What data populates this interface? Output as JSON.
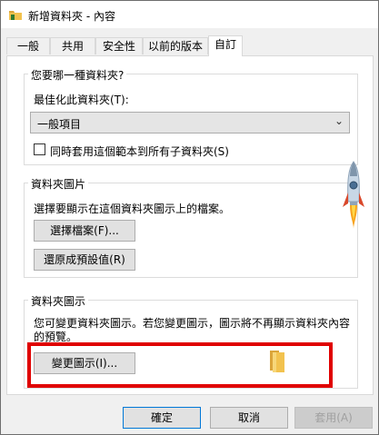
{
  "window": {
    "title": "新增資料夾 - 內容"
  },
  "tabs": [
    {
      "label": "一般",
      "active": false
    },
    {
      "label": "共用",
      "active": false
    },
    {
      "label": "安全性",
      "active": false
    },
    {
      "label": "以前的版本",
      "active": false
    },
    {
      "label": "自訂",
      "active": true
    }
  ],
  "optimize": {
    "group_title": "您要哪一種資料夾?",
    "label": "最佳化此資料夾(T):",
    "selected_value": "一般項目",
    "checkbox_label": "同時套用這個範本到所有子資料夾(S)",
    "checkbox_checked": false
  },
  "pictures": {
    "group_title": "資料夾圖片",
    "description": "選擇要顯示在這個資料夾圖示上的檔案。",
    "choose_file_label": "選擇檔案(F)...",
    "restore_default_label": "還原成預設值(R)"
  },
  "icons": {
    "group_title": "資料夾圖示",
    "description_line1": "您可變更資料夾圖示。若您變更圖示，圖示將不再顯示資料夾內容",
    "description_line2": "的預覽。",
    "change_icon_label": "變更圖示(I)..."
  },
  "footer": {
    "ok_label": "確定",
    "cancel_label": "取消",
    "apply_label": "套用(A)"
  },
  "colors": {
    "highlight": "#e00000",
    "folder": "#f2c24e",
    "focus": "#0078d7"
  }
}
